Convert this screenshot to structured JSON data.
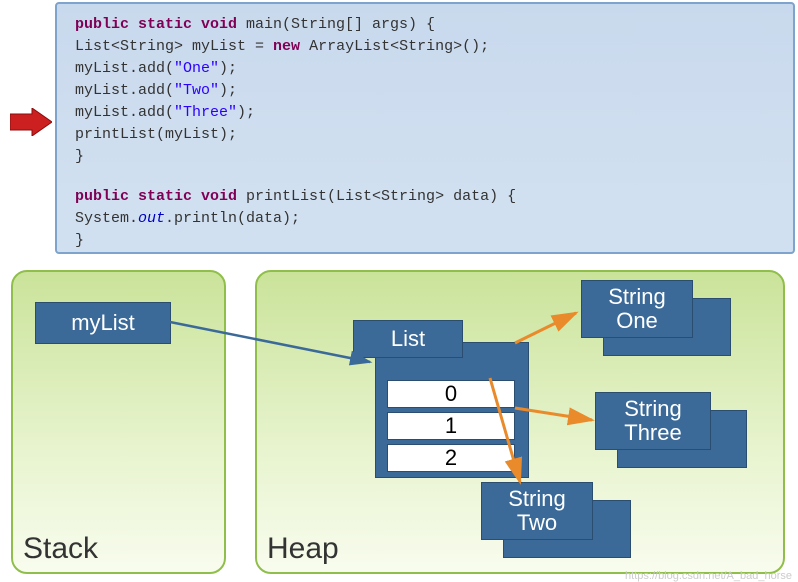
{
  "code": {
    "main_sig_1": "public static void",
    "main_sig_2": " main(String[] args) {",
    "line_decl_a": "    List<String> myList = ",
    "line_decl_new": "new",
    "line_decl_b": " ArrayList<String>();",
    "add1_a": "    myList.add(",
    "add1_s": "\"One\"",
    "add1_b": ");",
    "add2_a": "    myList.add(",
    "add2_s": "\"Two\"",
    "add2_b": ");",
    "add3_a": "    myList.add(",
    "add3_s": "\"Three\"",
    "add3_b": ");",
    "print_call": "    printList(myList);",
    "close1": "}",
    "printlist_sig_1": "public static void",
    "printlist_sig_2": " printList(List<String> data) {",
    "sysout_a": "    System.",
    "sysout_out": "out",
    "sysout_b": ".println(data);",
    "close2": "}"
  },
  "stack": {
    "label": "Stack",
    "var": "myList"
  },
  "heap": {
    "label": "Heap",
    "list": {
      "title": "List",
      "slots": [
        "0",
        "1",
        "2"
      ]
    },
    "strings": [
      {
        "type": "String",
        "value": "One"
      },
      {
        "type": "String",
        "value": "Three"
      },
      {
        "type": "String",
        "value": "Two"
      }
    ]
  },
  "watermark": "https://blog.csdn.net/A_bad_horse",
  "chart_data": {
    "type": "table",
    "title": "Java stack/heap reference diagram",
    "stack_frame": {
      "method": "main",
      "locals": [
        {
          "name": "myList",
          "points_to": "List"
        }
      ]
    },
    "heap_objects": [
      {
        "id": "List",
        "type": "ArrayList<String>",
        "elements": [
          {
            "index": 0,
            "ref": "StringOne"
          },
          {
            "index": 1,
            "ref": "StringTwo"
          },
          {
            "index": 2,
            "ref": "StringThree"
          }
        ]
      },
      {
        "id": "StringOne",
        "type": "String",
        "value": "One"
      },
      {
        "id": "StringTwo",
        "type": "String",
        "value": "Two"
      },
      {
        "id": "StringThree",
        "type": "String",
        "value": "Three"
      }
    ],
    "current_step": "about to enter printList(myList)"
  }
}
